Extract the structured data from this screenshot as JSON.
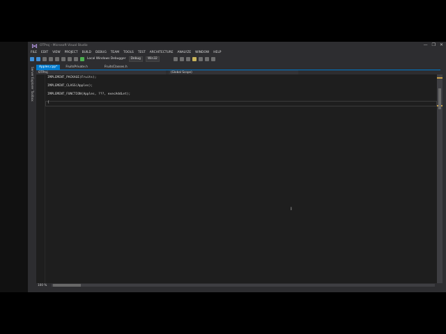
{
  "window": {
    "title": "OTProj - Microsoft Visual Studio",
    "minimize_glyph": "—",
    "restore_glyph": "❐",
    "close_glyph": "✕"
  },
  "menu": [
    "FILE",
    "EDIT",
    "VIEW",
    "PROJECT",
    "BUILD",
    "DEBUG",
    "TEAM",
    "TOOLS",
    "TEST",
    "ARCHITECTURE",
    "ANALYZE",
    "WINDOW",
    "HELP"
  ],
  "toolbar": {
    "debugger_label": "Local Windows Debugger",
    "config": "Debug",
    "platform": "Win32"
  },
  "side_panels": {
    "server_explorer": "Server Explorer",
    "toolbox": "Toolbox"
  },
  "tabs": [
    {
      "label": "Apples.cpp*",
      "active": true
    },
    {
      "label": "FruitsPrivate.h",
      "active": false
    },
    {
      "label": "FruitsClasses.h",
      "active": false
    }
  ],
  "navbar": {
    "project": "OTProj",
    "scope": "(Global Scope)"
  },
  "code": [
    "IMPLEMENT_PACKAGE(Fruits);",
    "IMPLEMENT_CLASS(Apples);",
    "IMPLEMENT_FUNCTION(Apples, ???, execAddLet);",
    "{"
  ],
  "status": {
    "zoom": "100 %"
  },
  "colors": {
    "accent": "#007acc",
    "background": "#2d2d30",
    "editor": "#1e1e1e"
  },
  "icons": [
    "visual-studio-logo",
    "back-icon",
    "forward-icon",
    "save-icon",
    "save-all-icon",
    "undo-icon",
    "redo-icon",
    "start-debug-icon"
  ]
}
